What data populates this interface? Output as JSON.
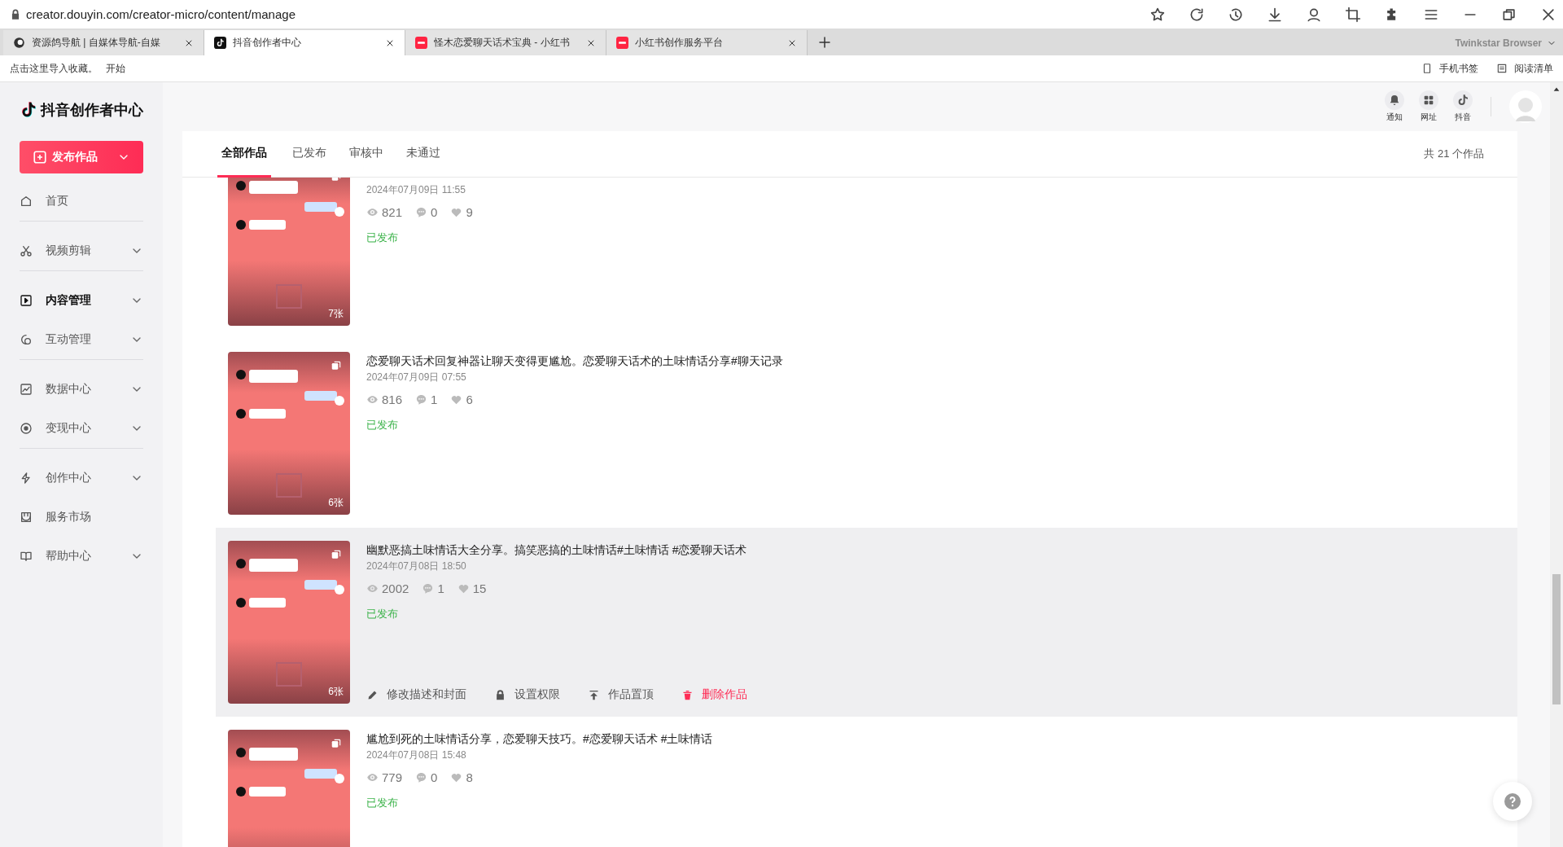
{
  "browser": {
    "url": "creator.douyin.com/creator-micro/content/manage",
    "tabs": [
      {
        "title": "资源鸽导航 | 自媒体导航-自媒",
        "kind": "globe",
        "selected": false
      },
      {
        "title": "抖音创作者中心",
        "kind": "douyin",
        "selected": true
      },
      {
        "title": "怪木恋爱聊天话术宝典 - 小红书",
        "kind": "xhs",
        "selected": false
      },
      {
        "title": "小红书创作服务平台",
        "kind": "xhs",
        "selected": false
      }
    ],
    "brand": "Twinkstar Browser",
    "bookmarks": {
      "hint": "点击这里导入收藏。",
      "start": "开始",
      "links": [
        "手机书签",
        "阅读清单"
      ]
    }
  },
  "sidebar": {
    "logo": "抖音创作者中心",
    "publish_button": "发布作品",
    "items": [
      {
        "label": "首页",
        "kind": "home",
        "selected": false,
        "expandable": false,
        "divider_after": true
      },
      {
        "label": "视频剪辑",
        "kind": "scissors",
        "selected": false,
        "expandable": true,
        "divider_after": true
      },
      {
        "label": "内容管理",
        "kind": "play",
        "selected": true,
        "expandable": true,
        "divider_after": false
      },
      {
        "label": "互动管理",
        "kind": "chat",
        "selected": false,
        "expandable": true,
        "divider_after": true
      },
      {
        "label": "数据中心",
        "kind": "chart",
        "selected": false,
        "expandable": true,
        "divider_after": false
      },
      {
        "label": "变现中心",
        "kind": "target",
        "selected": false,
        "expandable": true,
        "divider_after": true
      },
      {
        "label": "创作中心",
        "kind": "bolt",
        "selected": false,
        "expandable": true,
        "divider_after": false
      },
      {
        "label": "服务市场",
        "kind": "shop",
        "selected": false,
        "expandable": false,
        "divider_after": false
      },
      {
        "label": "帮助中心",
        "kind": "book",
        "selected": false,
        "expandable": true,
        "divider_after": false
      }
    ]
  },
  "header": {
    "actions": [
      {
        "label": "通知",
        "kind": "bell"
      },
      {
        "label": "网址",
        "kind": "grid"
      },
      {
        "label": "抖音",
        "kind": "note"
      }
    ]
  },
  "content": {
    "tabs": [
      {
        "label": "全部作品",
        "selected": true
      },
      {
        "label": "已发布",
        "selected": false
      },
      {
        "label": "审核中",
        "selected": false
      },
      {
        "label": "未通过",
        "selected": false
      }
    ],
    "total": "共 21 个作品",
    "works": [
      {
        "date": "2024年07月09日 11:55",
        "views": "821",
        "comments": "0",
        "likes": "9",
        "status": "已发布",
        "pages": "7张",
        "hovered": false
      },
      {
        "title": "恋爱聊天话术回复神器让聊天变得更尴尬。恋爱聊天话术的土味情话分享#聊天记录",
        "date": "2024年07月09日 07:55",
        "views": "816",
        "comments": "1",
        "likes": "6",
        "status": "已发布",
        "pages": "6张",
        "hovered": false
      },
      {
        "title": "幽默恶搞土味情话大全分享。搞笑恶搞的土味情话#土味情话 #恋爱聊天话术",
        "date": "2024年07月08日 18:50",
        "views": "2002",
        "comments": "1",
        "likes": "15",
        "status": "已发布",
        "pages": "6张",
        "hovered": true,
        "actions": [
          {
            "label": "修改描述和封面",
            "kind": "edit"
          },
          {
            "label": "设置权限",
            "kind": "lock"
          },
          {
            "label": "作品置顶",
            "kind": "pin"
          },
          {
            "label": "删除作品",
            "kind": "delete"
          }
        ]
      },
      {
        "title": "尴尬到死的土味情话分享，恋爱聊天技巧。#恋爱聊天话术 #土味情话",
        "date": "2024年07月08日 15:48",
        "views": "779",
        "comments": "0",
        "likes": "8",
        "status": "已发布",
        "hovered": false
      }
    ]
  }
}
